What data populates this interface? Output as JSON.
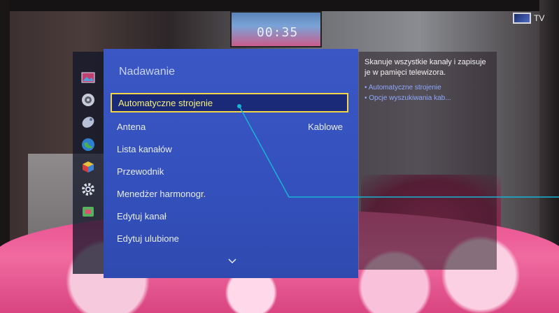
{
  "monitor_time": "00:35",
  "tv_badge": {
    "label": "TV",
    "icon": "tv-icon"
  },
  "sidebar": {
    "items": [
      {
        "icon": "picture-icon"
      },
      {
        "icon": "sound-icon"
      },
      {
        "icon": "broadcast-satellite-icon"
      },
      {
        "icon": "network-globe-icon"
      },
      {
        "icon": "smart-features-cube-icon"
      },
      {
        "icon": "system-gear-icon"
      },
      {
        "icon": "support-icon"
      }
    ]
  },
  "menu": {
    "title": "Nadawanie",
    "items": [
      {
        "label": "Automatyczne strojenie",
        "value": "",
        "selected": true
      },
      {
        "label": "Antena",
        "value": "Kablowe",
        "selected": false
      },
      {
        "label": "Lista kanałów",
        "value": "",
        "selected": false
      },
      {
        "label": "Przewodnik",
        "value": "",
        "selected": false
      },
      {
        "label": "Menedżer harmonogr.",
        "value": "",
        "selected": false
      },
      {
        "label": "Edytuj kanał",
        "value": "",
        "selected": false
      },
      {
        "label": "Edytuj ulubione",
        "value": "",
        "selected": false
      }
    ],
    "more_icon": "chevron-down-icon"
  },
  "help": {
    "description": "Skanuje wszystkie kanały i zapisuje je w pamięci telewizora.",
    "links": [
      "Automatyczne strojenie",
      "Opcje wyszukiwania kab..."
    ]
  },
  "colors": {
    "menu_bg": "#3a57c4",
    "selected_border": "#f3d54a",
    "selected_text": "#f7f07a",
    "help_link": "#8fa9ff",
    "annotation": "#19b3d6"
  }
}
